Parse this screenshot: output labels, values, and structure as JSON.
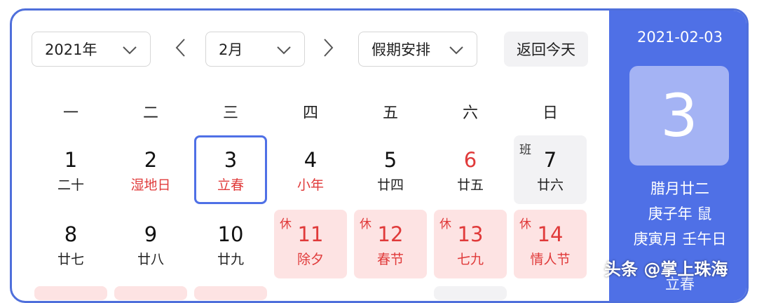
{
  "toolbar": {
    "year": "2021年",
    "month": "2月",
    "holiday": "假期安排",
    "today_button": "返回今天"
  },
  "weekdays": [
    "一",
    "二",
    "三",
    "四",
    "五",
    "六",
    "日"
  ],
  "rows": [
    [
      {
        "num": "1",
        "sub": "二十"
      },
      {
        "num": "2",
        "sub": "湿地日",
        "sub_red": true
      },
      {
        "num": "3",
        "sub": "立春",
        "sub_red": true,
        "selected": true
      },
      {
        "num": "4",
        "sub": "小年",
        "sub_red": true
      },
      {
        "num": "5",
        "sub": "廿四"
      },
      {
        "num": "6",
        "sub": "廿五",
        "num_red": true
      },
      {
        "num": "7",
        "sub": "廿六",
        "tag": "班",
        "work": true
      }
    ],
    [
      {
        "num": "8",
        "sub": "廿七"
      },
      {
        "num": "9",
        "sub": "廿八"
      },
      {
        "num": "10",
        "sub": "廿九"
      },
      {
        "num": "11",
        "sub": "除夕",
        "tag": "休",
        "rest": true
      },
      {
        "num": "12",
        "sub": "春节",
        "tag": "休",
        "rest": true
      },
      {
        "num": "13",
        "sub": "七九",
        "tag": "休",
        "rest": true
      },
      {
        "num": "14",
        "sub": "情人节",
        "tag": "休",
        "rest": true
      }
    ]
  ],
  "side": {
    "date": "2021-02-03",
    "day": "3",
    "lunar": "腊月廿二",
    "year_gz": "庚子年 鼠",
    "month_day_gz": "庚寅月 壬午日",
    "term": "立春"
  },
  "watermark": "头条 @掌上珠海",
  "colors": {
    "accent": "#4f70e6",
    "holiday_red": "#e03a3a",
    "rest_bg": "#fde3e3",
    "work_bg": "#f2f2f4"
  }
}
